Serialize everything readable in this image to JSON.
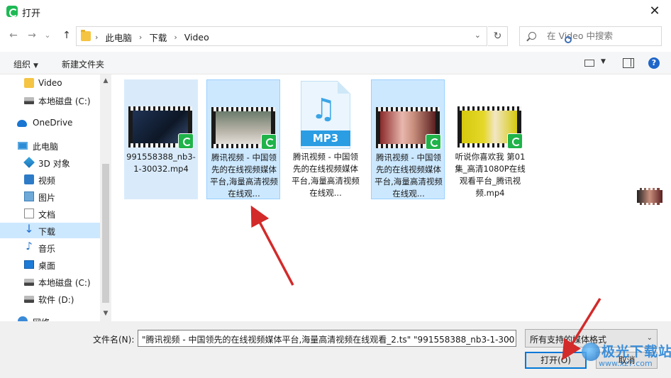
{
  "window": {
    "title": "打开",
    "app_icon": "tencent-video-icon",
    "close_glyph": "✕"
  },
  "nav_buttons": {
    "back": "←",
    "forward": "→",
    "recent": "⌄",
    "up": "↑"
  },
  "address": {
    "crumbs": [
      "此电脑",
      "下载",
      "Video"
    ],
    "separator": "›",
    "dropdown": "⌄",
    "refresh": "↻"
  },
  "search": {
    "placeholder": "在 Video 中搜索"
  },
  "toolbar": {
    "organize": "组织",
    "organize_caret": "▼",
    "new_folder": "新建文件夹",
    "view_caret": "▼",
    "help": "?"
  },
  "sidebar": {
    "items": [
      {
        "label": "Video",
        "icon": "folder-icon"
      },
      {
        "label": "本地磁盘 (C:)",
        "icon": "drive-icon"
      },
      {
        "label": "OneDrive",
        "icon": "onedrive-cloud-icon"
      },
      {
        "label": "此电脑",
        "icon": "this-pc-icon"
      },
      {
        "label": "3D 对象",
        "icon": "3d-objects-icon"
      },
      {
        "label": "视频",
        "icon": "videos-icon"
      },
      {
        "label": "图片",
        "icon": "pictures-icon"
      },
      {
        "label": "文档",
        "icon": "documents-icon"
      },
      {
        "label": "下载",
        "icon": "downloads-icon"
      },
      {
        "label": "音乐",
        "icon": "music-icon"
      },
      {
        "label": "桌面",
        "icon": "desktop-icon"
      },
      {
        "label": "本地磁盘 (C:)",
        "icon": "drive-icon"
      },
      {
        "label": "软件 (D:)",
        "icon": "drive-icon"
      },
      {
        "label": "网络",
        "icon": "network-icon"
      }
    ],
    "selected": "下载",
    "scroll_up": "▲",
    "scroll_down": "▼"
  },
  "files": [
    {
      "name": "991558388_nb3-1-30032.mp4",
      "type": "video",
      "selected": true
    },
    {
      "name": "腾讯视频 - 中国领先的在线视频媒体平台,海量高清视频在线观...",
      "type": "video",
      "selected": true
    },
    {
      "name": "腾讯视频 - 中国领先的在线视频媒体平台,海量高清视频在线观...",
      "type": "mp3",
      "selected": false,
      "thumb_label": "MP3",
      "thumb_glyph": "♫"
    },
    {
      "name": "腾讯视频 - 中国领先的在线视频媒体平台,海量高清视频在线观...",
      "type": "video",
      "selected": true
    },
    {
      "name": "听说你喜欢我 第01集_高清1080P在线观看平台_腾讯视频.mp4",
      "type": "video",
      "selected": false
    }
  ],
  "bottom": {
    "filename_label": "文件名(N):",
    "filename_value": "\"腾讯视频 - 中国领先的在线视频媒体平台,海量高清视频在线观看_2.ts\" \"991558388_nb3-1-300",
    "filename_dropdown": "⌄",
    "filetype_value": "所有支持的媒体格式",
    "filetype_dropdown": "⌄",
    "open_button": "打开(O)",
    "cancel_button": "取消"
  },
  "watermark": {
    "text": "极光下载站",
    "url": "www.xz7.com"
  },
  "colors": {
    "selection": "#cce8ff",
    "accent": "#0078d7",
    "annotation_arrow": "#d32a2a",
    "badge": "#1fb34a"
  }
}
